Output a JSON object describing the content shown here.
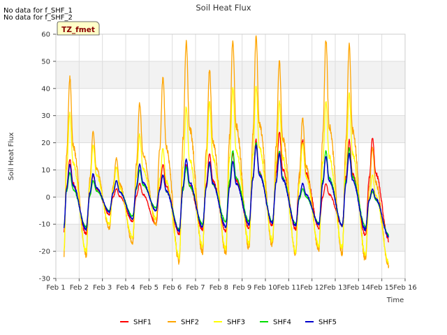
{
  "notes": [
    "No data for f_SHF_1",
    "No data for f_SHF_2"
  ],
  "badge": "TZ_fmet",
  "chart_data": {
    "type": "line",
    "title": "Soil Heat Flux",
    "xlabel": "Time",
    "ylabel": "Soil Heat Flux",
    "xlim": [
      1,
      16
    ],
    "ylim": [
      -30,
      60
    ],
    "xticks": [
      1,
      2,
      3,
      4,
      5,
      6,
      7,
      8,
      9,
      10,
      11,
      12,
      13,
      14,
      15,
      16
    ],
    "xtick_labels": [
      "Feb 1",
      "Feb 2",
      "Feb 3",
      "Feb 4",
      "Feb 5",
      "Feb 6",
      "Feb 7",
      "Feb 8",
      "Feb 9",
      "Feb 10",
      "Feb 11",
      "Feb 12",
      "Feb 13",
      "Feb 14",
      "Feb 15",
      "Feb 16"
    ],
    "yticks": [
      -30,
      -20,
      -10,
      0,
      10,
      20,
      30,
      40,
      50,
      60
    ],
    "ytick_labels": [
      "-30",
      "-20",
      "-10",
      "0",
      "10",
      "20",
      "30",
      "40",
      "50",
      "60"
    ],
    "grid": true,
    "legend_position": "bottom-center",
    "days": [
      1.6,
      2.6,
      3.6,
      4.6,
      5.6,
      6.6,
      7.6,
      8.6,
      9.6,
      10.6,
      11.6,
      12.6,
      13.6,
      14.6
    ],
    "start_x": 1.35,
    "end_x": 15.3,
    "series": [
      {
        "name": "SHF1",
        "color": "#ff0000",
        "width": 1.3,
        "peaks": [
          14,
          8,
          3,
          5,
          12,
          12,
          16,
          16,
          21,
          24,
          21,
          5,
          21,
          22
        ],
        "troughs": [
          -12.5,
          -13.5,
          -6.5,
          -9,
          -10,
          -13.5,
          -12,
          -12.5,
          -11.5,
          -10.5,
          -12,
          -11.5,
          -10.5,
          -14,
          -16
        ]
      },
      {
        "name": "SHF2",
        "color": "#ffa500",
        "width": 1.3,
        "peaks": [
          44,
          24,
          14.5,
          34.5,
          44,
          57,
          47,
          58,
          59,
          50,
          29,
          58,
          56,
          18
        ],
        "troughs": [
          -21,
          -21.5,
          -11.5,
          -17,
          -10,
          -24,
          -20.5,
          -20.5,
          -19,
          -18,
          -21,
          -19.5,
          -20.5,
          -23,
          -25.5
        ]
      },
      {
        "name": "SHF3",
        "color": "#ffff00",
        "width": 1.3,
        "peaks": [
          31,
          19,
          11,
          23,
          18,
          33,
          35,
          40,
          41,
          35,
          20,
          35,
          38,
          8
        ],
        "troughs": [
          -19,
          -20,
          -10,
          -15,
          -8,
          -22,
          -18,
          -19,
          -17,
          -16,
          -20,
          -18,
          -18.5,
          -21,
          -24
        ]
      },
      {
        "name": "SHF4",
        "color": "#00dd00",
        "width": 1.3,
        "peaks": [
          9,
          6,
          6,
          10,
          8,
          11,
          12,
          17,
          20,
          17,
          3,
          17,
          18,
          2
        ],
        "troughs": [
          -10,
          -11,
          -5,
          -7,
          -4,
          -12,
          -10,
          -9,
          -9,
          -9,
          -10,
          -9.5,
          -10.5,
          -11,
          -14
        ]
      },
      {
        "name": "SHF5",
        "color": "#0000cc",
        "width": 1.5,
        "peaks": [
          12,
          8.5,
          6,
          12,
          8,
          14,
          13,
          13,
          19,
          16,
          5,
          15,
          16,
          3
        ],
        "troughs": [
          -11,
          -12,
          -5.5,
          -8,
          -5,
          -12.5,
          -11,
          -11,
          -10,
          -9.5,
          -10.5,
          -10,
          -10.5,
          -12,
          -14.5
        ]
      }
    ]
  }
}
